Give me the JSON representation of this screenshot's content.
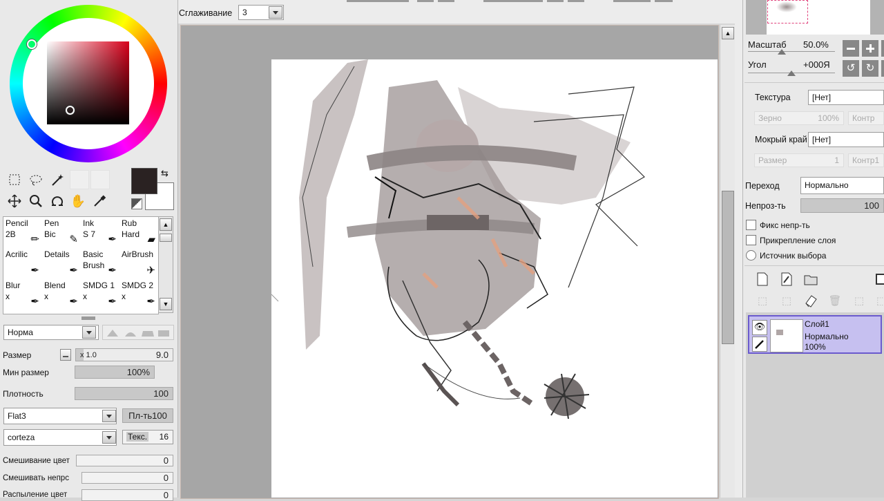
{
  "top": {
    "smoothing_label": "Сглаживание",
    "smoothing_value": "3"
  },
  "colors": {
    "foreground": "#2a2222",
    "background": "#ffffff",
    "accent": "#c6c0f0"
  },
  "tools_icons": [
    "rect-select-icon",
    "lasso-select-icon",
    "magic-wand-icon",
    "move-icon",
    "zoom-icon",
    "rotate-icon",
    "hand-icon",
    "eyedropper-icon"
  ],
  "brushes": [
    {
      "name": "Pencil",
      "sub": "2B"
    },
    {
      "name": "Pen",
      "sub": "Bic"
    },
    {
      "name": "Ink",
      "sub": "S 7"
    },
    {
      "name": "Rub",
      "sub": "Hard"
    },
    {
      "name": "Acrilic",
      "sub": ""
    },
    {
      "name": "Details",
      "sub": ""
    },
    {
      "name": "Basic",
      "sub": "Brush"
    },
    {
      "name": "AirBrush",
      "sub": ""
    },
    {
      "name": "Blur",
      "sub": "x"
    },
    {
      "name": "Blend",
      "sub": "x"
    },
    {
      "name": "SMDG 1",
      "sub": "x"
    },
    {
      "name": "SMDG 2",
      "sub": "x"
    }
  ],
  "brush_settings": {
    "blend_mode": "Норма",
    "size_label": "Размер",
    "size_mult": "x 1.0",
    "size_value": "9.0",
    "min_size_label": "Мин размер",
    "min_size_value": "100%",
    "density_label": "Плотность",
    "density_value": "100",
    "shape": "Flat3",
    "shape_strength": "Пл-ть100",
    "texture": "corteza",
    "texture_label": "Текс.",
    "texture_value": "16",
    "mix_color_label": "Смешивание цвет",
    "mix_color_value": "0",
    "mix_opacity_label": "Смешивать непрс",
    "mix_opacity_value": "0",
    "spread_label": "Распыление цвет",
    "spread_value": "0"
  },
  "navigator": {
    "zoom_label": "Масштаб",
    "zoom_value": "50.0%",
    "angle_label": "Угол",
    "angle_value": "+000Я"
  },
  "layer_props": {
    "texture_label": "Текстура",
    "texture_value": "[Нет]",
    "grain_label": "Зерно",
    "grain_value": "100%",
    "contrast_label": "Контр",
    "wet_label": "Мокрый край",
    "wet_value": "[Нет]",
    "size_label": "Размер",
    "size_value": "1",
    "contrast2_label": "Контр1",
    "blend_label": "Переход",
    "blend_value": "Нормально",
    "opacity_label": "Непроз-ть",
    "opacity_value": "100",
    "fix_opacity": "Фикс непр-ть",
    "clip_layer": "Прикрепление слоя",
    "selection_source": "Источник выбора"
  },
  "layers": [
    {
      "name": "Слой1",
      "mode": "Нормально",
      "opacity": "100%"
    }
  ]
}
